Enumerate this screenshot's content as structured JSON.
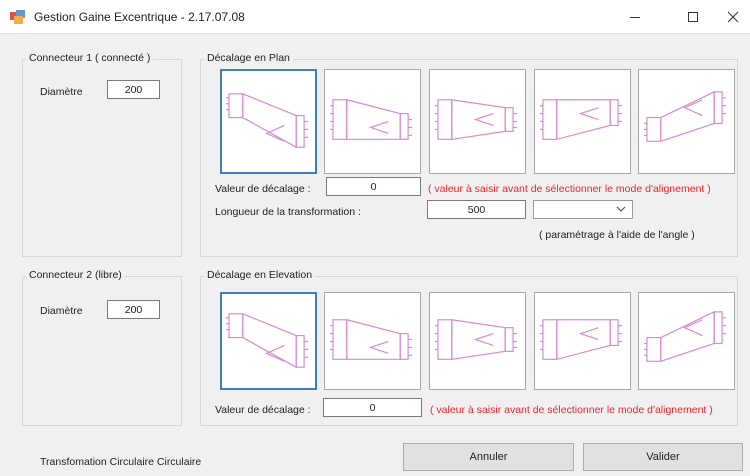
{
  "window": {
    "title": "Gestion Gaine Excentrique - 2.17.07.08",
    "icon": "app-window-icon",
    "controls": [
      "minimize-icon",
      "maximize-icon",
      "close-icon"
    ]
  },
  "connector1": {
    "title": "Connecteur 1 ( connecté )",
    "diameter_label": "Diamètre",
    "diameter_value": "200"
  },
  "connector2": {
    "title": "Connecteur 2 (libre)",
    "diameter_label": "Diamètre",
    "diameter_value": "200"
  },
  "plan": {
    "title": "Décalage en Plan",
    "offset_label": "Valeur de décalage :",
    "offset_value": "0",
    "offset_hint": "( valeur à saisir avant de sélectionner le mode d'alignement )",
    "length_label": "Longueur de la transformation :",
    "length_value": "500",
    "angle_value": "",
    "angle_hint": "( paramétrage à l'aide de l'angle )",
    "selected_mode": 1
  },
  "elevation": {
    "title": "Décalage en Elevation",
    "offset_label": "Valeur de décalage :",
    "offset_value": "0",
    "offset_hint": "( valeur à saisir avant de sélectionner le mode d'alignement )",
    "selected_mode": 1
  },
  "footer": {
    "status": "Transfomation Circulaire Circulaire",
    "cancel_label": "Annuler",
    "ok_label": "Valider"
  },
  "colors": {
    "duct": "#d98ad0",
    "hint": "#e8262c",
    "selection": "#3c7fc4"
  }
}
